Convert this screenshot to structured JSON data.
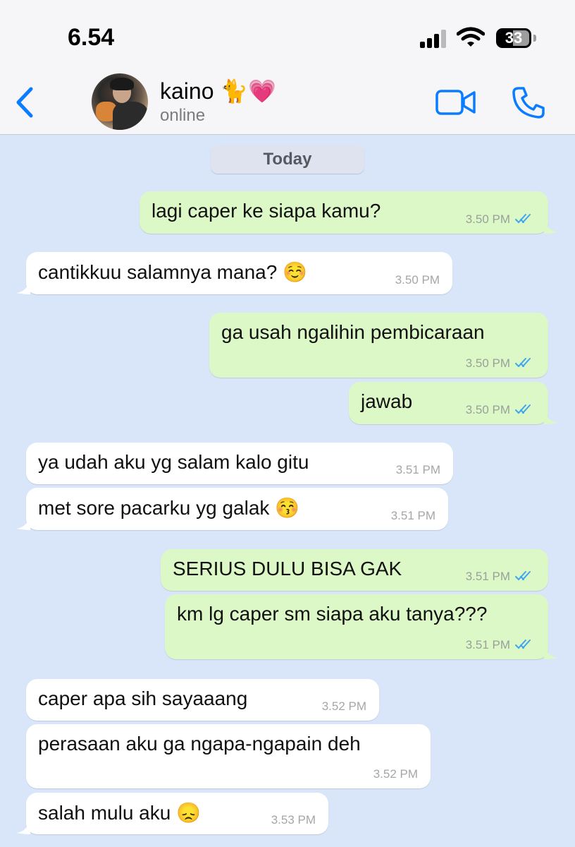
{
  "status_bar": {
    "time": "6.54",
    "battery": "33"
  },
  "header": {
    "contact_name": "kaino 🐈💗",
    "status": "online"
  },
  "date_divider": "Today",
  "messages": [
    {
      "dir": "out",
      "text": "lagi caper ke siapa kamu?",
      "time": "3.50 PM",
      "tail": true
    },
    {
      "dir": "in",
      "text": "cantikkuu salamnya mana? ☺️",
      "time": "3.50 PM",
      "tail": true
    },
    {
      "dir": "out",
      "text": "ga usah ngalihin pembicaraan",
      "time": "3.50 PM",
      "tail": false
    },
    {
      "dir": "out",
      "text": "jawab",
      "time": "3.50 PM",
      "tail": true
    },
    {
      "dir": "in",
      "text": "ya udah aku yg salam kalo gitu",
      "time": "3.51 PM",
      "tail": false
    },
    {
      "dir": "in",
      "text": "met sore pacarku yg galak 😚",
      "time": "3.51 PM",
      "tail": true
    },
    {
      "dir": "out",
      "text": "SERIUS DULU BISA GAK",
      "time": "3.51 PM",
      "tail": false
    },
    {
      "dir": "out",
      "text": "km lg caper sm siapa aku tanya???",
      "time": "3.51 PM",
      "tail": true
    },
    {
      "dir": "in",
      "text": "caper apa sih sayaaang",
      "time": "3.52 PM",
      "tail": false
    },
    {
      "dir": "in",
      "text": "perasaan aku ga ngapa-ngapain deh",
      "time": "3.52 PM",
      "tail": false
    },
    {
      "dir": "in",
      "text": "salah mulu aku 😞",
      "time": "3.53 PM",
      "tail": true
    }
  ],
  "colors": {
    "accent": "#0a7cff",
    "outgoing_bubble": "#dcf8c6",
    "incoming_bubble": "#ffffff",
    "chat_background": "#d9e6f9",
    "read_ticks": "#3ea6ef"
  },
  "icons": [
    "signal-icon",
    "wifi-icon",
    "battery-icon",
    "back-chevron-icon",
    "video-call-icon",
    "phone-call-icon",
    "read-receipt-icon"
  ]
}
